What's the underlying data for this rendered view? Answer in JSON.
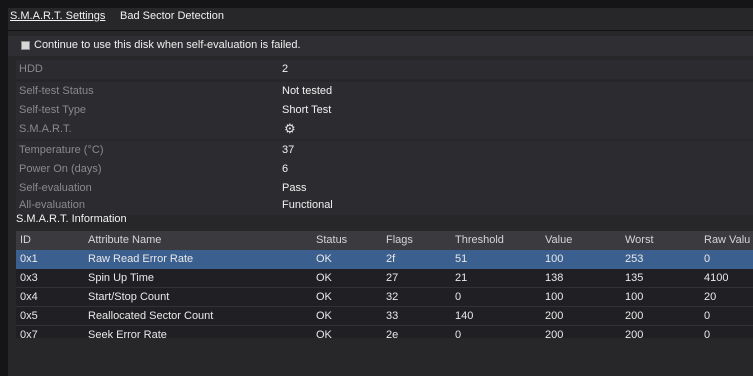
{
  "tabs": [
    {
      "label": "S.M.A.R.T. Settings"
    },
    {
      "label": "Bad Sector Detection"
    }
  ],
  "checkbox_label": "Continue to use this disk when self-evaluation is failed.",
  "info": {
    "hdd_label": "HDD",
    "hdd_value": "2",
    "selftest_status_label": "Self-test Status",
    "selftest_status_value": "Not tested",
    "selftest_type_label": "Self-test Type",
    "selftest_type_value": "Short Test",
    "smart_label": "S.M.A.R.T.",
    "smart_icon": "gear-icon",
    "temperature_label": "Temperature (°C)",
    "temperature_value": "37",
    "power_on_label": "Power On (days)",
    "power_on_value": "6",
    "self_eval_label": "Self-evaluation",
    "self_eval_value": "Pass",
    "all_eval_label": "All-evaluation",
    "all_eval_value": "Functional"
  },
  "section_title": "S.M.A.R.T. Information",
  "table": {
    "headers": [
      "ID",
      "Attribute Name",
      "Status",
      "Flags",
      "Threshold",
      "Value",
      "Worst",
      "Raw Valu"
    ],
    "rows": [
      [
        "0x1",
        "Raw Read Error Rate",
        "OK",
        "2f",
        "51",
        "100",
        "253",
        "0"
      ],
      [
        "0x3",
        "Spin Up Time",
        "OK",
        "27",
        "21",
        "138",
        "135",
        "4100"
      ],
      [
        "0x4",
        "Start/Stop Count",
        "OK",
        "32",
        "0",
        "100",
        "100",
        "20"
      ],
      [
        "0x5",
        "Reallocated Sector Count",
        "OK",
        "33",
        "140",
        "200",
        "200",
        "0"
      ],
      [
        "0x7",
        "Seek Error Rate",
        "OK",
        "2e",
        "0",
        "200",
        "200",
        "0"
      ]
    ]
  },
  "colors": {
    "selected_row": "#3b5f8f",
    "background": "#27272a"
  }
}
